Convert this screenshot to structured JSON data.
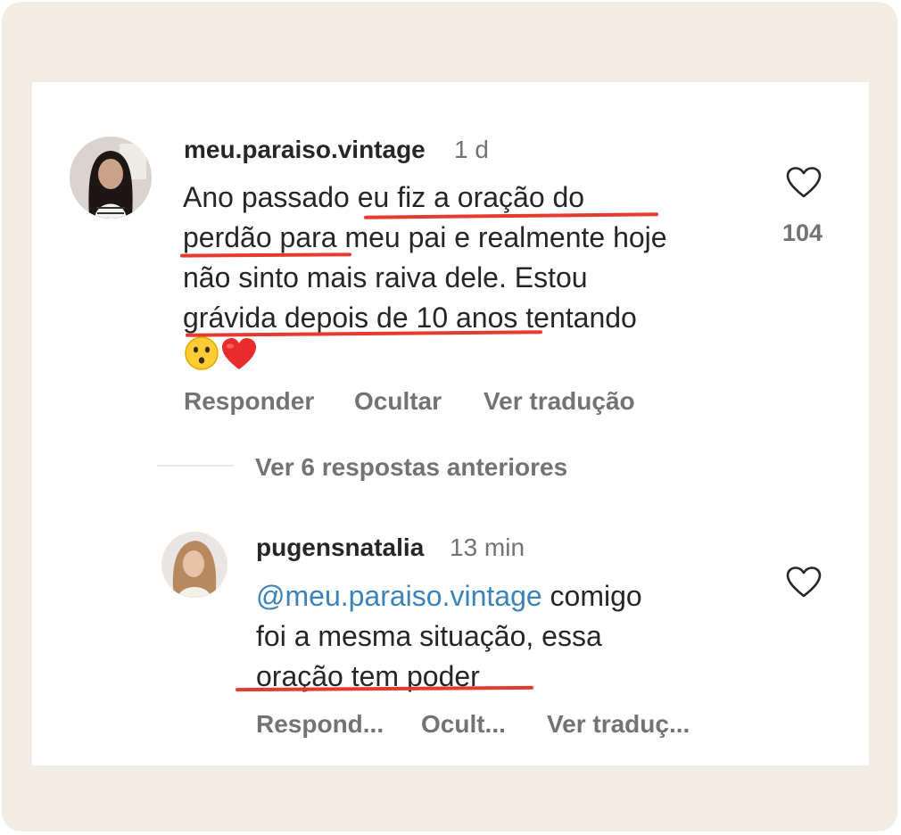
{
  "colors": {
    "accent_underline": "#e53a2f",
    "mention": "#3b82b8",
    "frame": "#f1ece4"
  },
  "comment": {
    "username": "meu.paraiso.vintage",
    "time": "1 d",
    "lines": [
      "Ano passado eu fiz a oração do",
      "perdão para meu pai e realmente hoje",
      "não sinto mais raiva dele. Estou",
      "grávida depois de 10 anos tentando"
    ],
    "emojis": [
      "hushed-face",
      "red-heart"
    ],
    "like_count": "104",
    "actions": {
      "reply": "Responder",
      "hide": "Ocultar",
      "translate": "Ver tradução"
    }
  },
  "view_replies": "Ver 6 respostas anteriores",
  "reply": {
    "username": "pugensnatalia",
    "time": "13 min",
    "mention": "@meu.paraiso.vintage",
    "line1_rest": " comigo",
    "line2": "foi a mesma situação, essa",
    "line3": "oração tem poder",
    "actions": {
      "reply": "Respond...",
      "hide": "Ocult...",
      "translate": "Ver traduç..."
    }
  }
}
